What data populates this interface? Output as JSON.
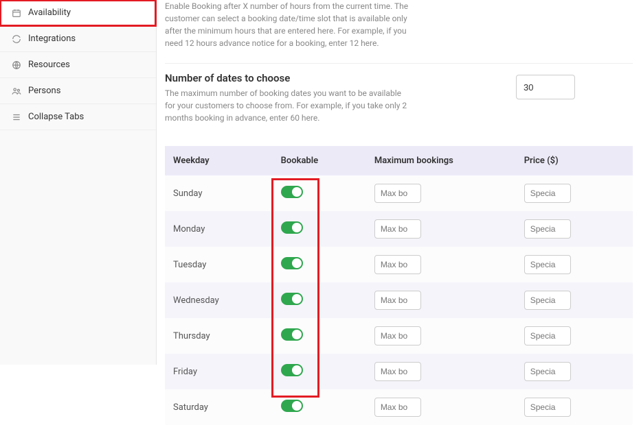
{
  "sidebar": {
    "items": [
      {
        "label": "Availability"
      },
      {
        "label": "Integrations"
      },
      {
        "label": "Resources"
      },
      {
        "label": "Persons"
      },
      {
        "label": "Collapse Tabs"
      }
    ]
  },
  "sections": {
    "advance_notice": {
      "desc": "Enable Booking after X number of hours from the current time. The customer can select a booking date/time slot that is available only after the minimum hours that are entered here. For example, if you need 12 hours advance notice for a booking, enter 12 here."
    },
    "num_dates": {
      "title": "Number of dates to choose",
      "desc": "The maximum number of booking dates you want to be available for your customers to choose from. For example, if you take only 2 months booking in advance, enter 60 here.",
      "value": "30"
    }
  },
  "table": {
    "headers": {
      "weekday": "Weekday",
      "bookable": "Bookable",
      "max": "Maximum bookings",
      "price": "Price ($)"
    },
    "max_placeholder": "Max bo",
    "price_placeholder": "Specia",
    "rows": [
      {
        "day": "Sunday"
      },
      {
        "day": "Monday"
      },
      {
        "day": "Tuesday"
      },
      {
        "day": "Wednesday"
      },
      {
        "day": "Thursday"
      },
      {
        "day": "Friday"
      },
      {
        "day": "Saturday"
      }
    ]
  }
}
